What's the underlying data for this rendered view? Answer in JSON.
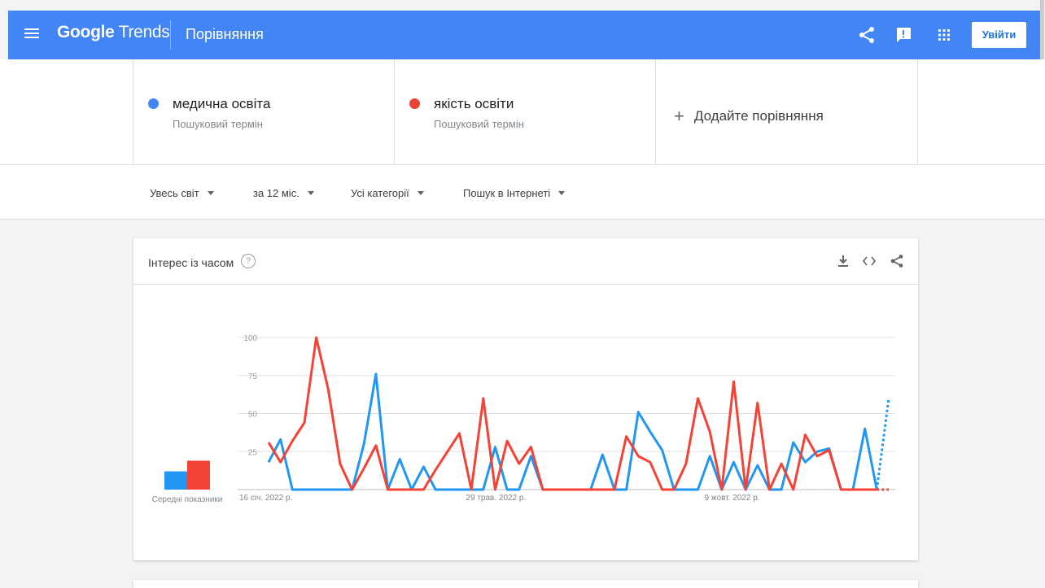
{
  "header": {
    "logo_google": "Google",
    "logo_trends": "Trends",
    "page_title": "Порівняння",
    "signin_label": "Увійти",
    "icons": [
      "menu-icon",
      "share-icon",
      "feedback-icon",
      "apps-icon"
    ]
  },
  "terms": [
    {
      "name": "медична освіта",
      "type": "Пошуковий термін",
      "color": "#4285f4"
    },
    {
      "name": "якість освіти",
      "type": "Пошуковий термін",
      "color": "#ea4335"
    }
  ],
  "add_comparison": "Додайте порівняння",
  "filters": {
    "region": "Увесь світ",
    "period": "за 12 міс.",
    "category": "Усі категорії",
    "search_type": "Пошук в Інтернеті"
  },
  "card": {
    "title": "Інтерес із часом",
    "help": "?",
    "icons": [
      "download-icon",
      "embed-icon",
      "share-icon"
    ]
  },
  "colors": {
    "brand": "#4285f4",
    "series1": "#2196f3",
    "series2": "#f44336"
  },
  "chart_data": {
    "type": "line",
    "x_tick_labels": [
      "16 січ. 2022 р.",
      "29 трав. 2022 р.",
      "9 жовт. 2022 р."
    ],
    "x_tick_indices": [
      0,
      19,
      39
    ],
    "ylim": [
      0,
      100
    ],
    "y_ticks": [
      25,
      50,
      75,
      100
    ],
    "average_label": "Середні показники",
    "averages": [
      12,
      19
    ],
    "partial_last_point": true,
    "series": [
      {
        "name": "медична освіта",
        "color": "#2196f3",
        "values": [
          18,
          33,
          0,
          0,
          0,
          0,
          0,
          0,
          30,
          76,
          0,
          20,
          0,
          15,
          0,
          0,
          0,
          0,
          0,
          28,
          0,
          0,
          22,
          0,
          0,
          0,
          0,
          0,
          23,
          0,
          0,
          51,
          38,
          26,
          0,
          0,
          0,
          22,
          0,
          18,
          0,
          16,
          0,
          0,
          31,
          18,
          25,
          27,
          0,
          0,
          40,
          0,
          60
        ]
      },
      {
        "name": "якість освіти",
        "color": "#f44336",
        "values": [
          31,
          18,
          32,
          44,
          100,
          66,
          17,
          0,
          14,
          29,
          0,
          0,
          0,
          0,
          13,
          25,
          37,
          0,
          60,
          0,
          32,
          17,
          28,
          0,
          0,
          0,
          0,
          0,
          0,
          0,
          35,
          22,
          18,
          0,
          0,
          17,
          60,
          38,
          0,
          71,
          0,
          57,
          0,
          17,
          0,
          36,
          22,
          26,
          0,
          0,
          0,
          0,
          0
        ]
      }
    ]
  }
}
